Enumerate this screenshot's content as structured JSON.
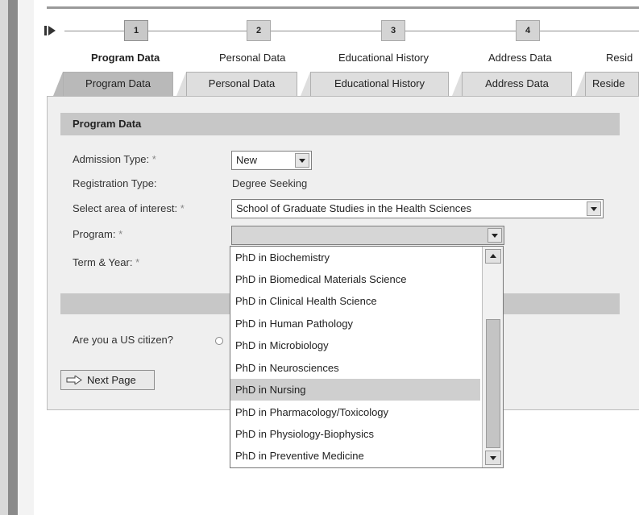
{
  "roadmap": {
    "start_icon": "roadmap-start-arrow",
    "steps": [
      {
        "number": "1",
        "label": "Program Data"
      },
      {
        "number": "2",
        "label": "Personal Data"
      },
      {
        "number": "3",
        "label": "Educational History"
      },
      {
        "number": "4",
        "label": "Address Data"
      },
      {
        "label": "Resid"
      }
    ]
  },
  "tabs": [
    {
      "label": "Program Data"
    },
    {
      "label": "Personal Data"
    },
    {
      "label": "Educational History"
    },
    {
      "label": "Address Data"
    },
    {
      "label": "Reside"
    }
  ],
  "section": {
    "title": "Program Data"
  },
  "form": {
    "admission_type": {
      "label": "Admission Type:",
      "required_mark": "*",
      "value": "New"
    },
    "registration_type": {
      "label": "Registration Type:",
      "value": "Degree Seeking"
    },
    "area_of_interest": {
      "label": "Select area of interest:",
      "required_mark": "*",
      "value": "School of Graduate Studies in the Health Sciences"
    },
    "program": {
      "label": "Program:",
      "required_mark": "*",
      "value": ""
    },
    "term_year": {
      "label": "Term & Year:",
      "required_mark": "*"
    },
    "us_citizen": {
      "label": "Are you a US citizen?"
    }
  },
  "next_button": {
    "label": "Next Page",
    "icon": "arrow-right-icon"
  },
  "program_dropdown": {
    "options": [
      "PhD in Biochemistry",
      "PhD in Biomedical Materials Science",
      "PhD in Clinical Health Science",
      "PhD in Human Pathology",
      "PhD in Microbiology",
      "PhD in Neurosciences",
      "PhD in Nursing",
      "PhD in Pharmacology/Toxicology",
      "PhD in Physiology-Biophysics",
      "PhD in Preventive Medicine"
    ],
    "highlighted": "PhD in Nursing"
  }
}
